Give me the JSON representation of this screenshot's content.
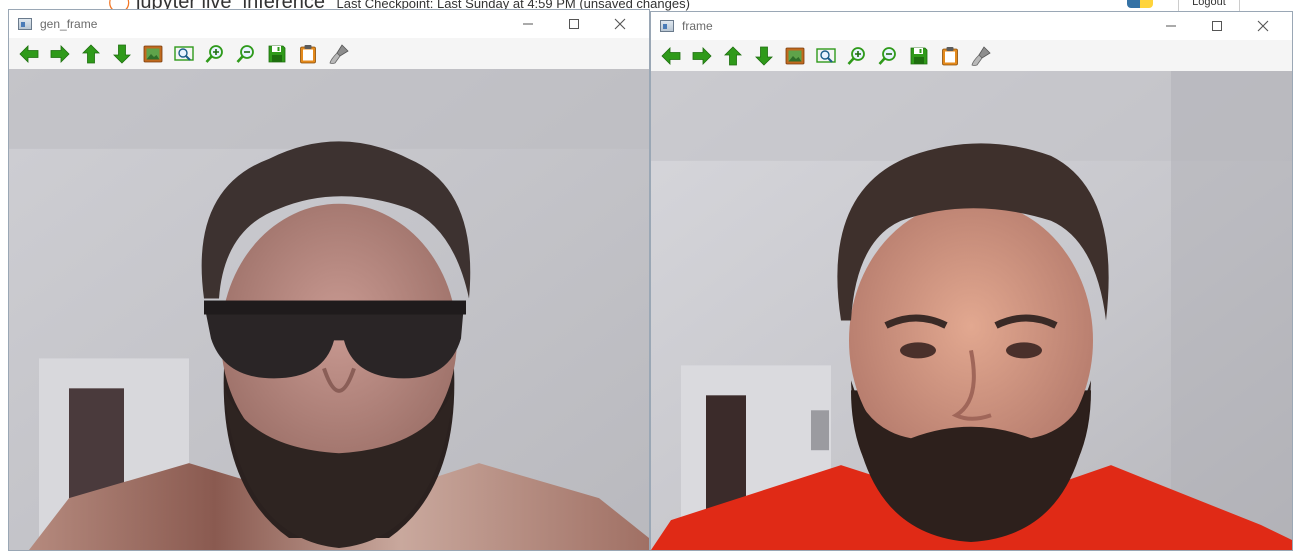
{
  "background": {
    "app_title": "jupyter",
    "notebook_name": "live_inference",
    "checkpoint": "Last Checkpoint: Last Sunday at 4:59 PM  (unsaved changes)",
    "logout": "Logout"
  },
  "windows": [
    {
      "title": "gen_frame",
      "toolbar": [
        "arrow-left-icon",
        "arrow-right-icon",
        "arrow-up-icon",
        "arrow-down-icon",
        "image-icon",
        "zoom-fit-icon",
        "zoom-in-icon",
        "zoom-out-icon",
        "save-icon",
        "clipboard-icon",
        "brush-icon"
      ],
      "image_description": "webcam frame with sunglasses"
    },
    {
      "title": "frame",
      "toolbar": [
        "arrow-left-icon",
        "arrow-right-icon",
        "arrow-up-icon",
        "arrow-down-icon",
        "image-icon",
        "zoom-fit-icon",
        "zoom-in-icon",
        "zoom-out-icon",
        "save-icon",
        "clipboard-icon",
        "brush-icon"
      ],
      "image_description": "webcam frame"
    }
  ],
  "colors": {
    "toolbar_green": "#2f9a1a",
    "shirt_red": "#e02a16",
    "titlebar_text": "#6b6b6b"
  }
}
